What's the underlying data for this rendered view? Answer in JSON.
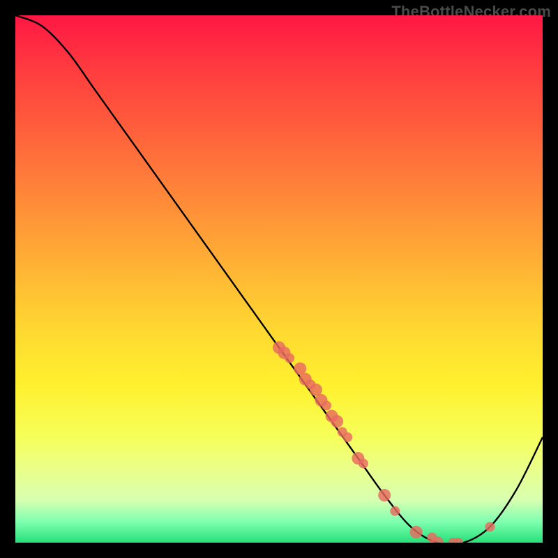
{
  "watermark": "TheBottleNecker.com",
  "chart_data": {
    "type": "line",
    "title": "",
    "xlabel": "",
    "ylabel": "",
    "xlim": [
      0,
      100
    ],
    "ylim": [
      0,
      100
    ],
    "grid": false,
    "legend": false,
    "series": [
      {
        "name": "bottleneck-curve",
        "x": [
          0,
          5,
          10,
          15,
          20,
          25,
          30,
          35,
          40,
          45,
          50,
          55,
          60,
          65,
          70,
          75,
          80,
          85,
          90,
          95,
          100
        ],
        "y": [
          100,
          98,
          93,
          86,
          79,
          72,
          65,
          58,
          51,
          44,
          37,
          30,
          23,
          16,
          9,
          3,
          0,
          0,
          3,
          10,
          20
        ]
      }
    ],
    "markers": {
      "name": "data-points",
      "x": [
        50,
        51,
        52,
        54,
        55,
        56,
        57,
        58,
        59,
        60,
        61,
        62,
        63,
        65,
        66,
        70,
        72,
        76,
        79,
        80,
        83,
        84,
        90
      ],
      "y": [
        37,
        36,
        35,
        33,
        31,
        30,
        29,
        27,
        26,
        24,
        23,
        21,
        20,
        16,
        15,
        9,
        6,
        2,
        1,
        0,
        0,
        0,
        3
      ],
      "r": [
        9,
        9,
        7,
        9,
        9,
        7,
        9,
        9,
        7,
        9,
        9,
        7,
        7,
        9,
        7,
        9,
        7,
        9,
        7,
        9,
        7,
        7,
        7
      ]
    },
    "background": {
      "type": "vertical-gradient",
      "stops": [
        {
          "pos": 0.0,
          "color": "#ff1744"
        },
        {
          "pos": 0.5,
          "color": "#ffba34"
        },
        {
          "pos": 0.8,
          "color": "#f6ff5a"
        },
        {
          "pos": 1.0,
          "color": "#26e07a"
        }
      ]
    }
  }
}
